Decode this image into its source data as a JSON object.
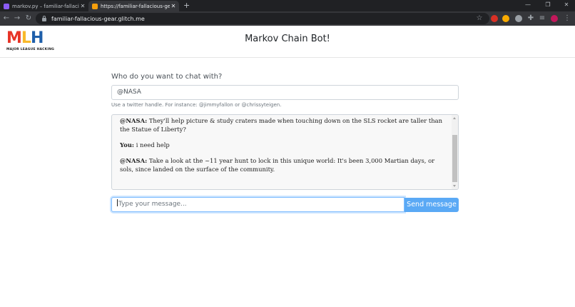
{
  "browser": {
    "tabs": [
      {
        "label": "markov.py – familiar-fallacious-g",
        "active": false,
        "favicon_color": "#8b5cf6"
      },
      {
        "label": "https://familiar-fallacious-gear.gl",
        "active": true,
        "favicon_color": "#f59e0b"
      }
    ],
    "new_tab_symbol": "+",
    "url": "familiar-fallacious-gear.glitch.me"
  },
  "header": {
    "logo_letters": [
      "M",
      "L",
      "H"
    ],
    "logo_colors": [
      "#e73427",
      "#f8b92a",
      "#1f5faa"
    ],
    "logo_subtitle": "MAJOR LEAGUE HACKING",
    "title": "Markov Chain Bot!"
  },
  "form": {
    "question": "Who do you want to chat with?",
    "handle_value": "@NASA",
    "help_text": "Use a twitter handle. For instance: @jimmyfallon or @chrissyteigen."
  },
  "chat": {
    "messages": [
      {
        "sender": "@NASA:",
        "text": "They'll help picture & study craters made when touching down on the SLS rocket are taller than the Statue of Liberty?"
      },
      {
        "sender": "You:",
        "text": "i need help"
      },
      {
        "sender": "@NASA:",
        "text": "Take a look at the ~11 year hunt to lock in this unique world: It's been 3,000 Martian days, or sols, since landed on the surface of the community."
      }
    ]
  },
  "composer": {
    "placeholder": "Type your message...",
    "send_label": "Send message"
  }
}
